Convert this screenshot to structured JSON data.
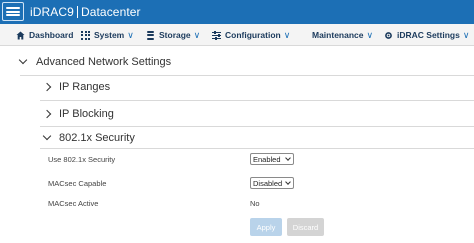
{
  "header": {
    "product": "iDRAC9",
    "edition": "Datacenter"
  },
  "nav": {
    "items": [
      {
        "label": "Dashboard",
        "icon": "home-icon",
        "has_menu": false
      },
      {
        "label": "System",
        "icon": "grid-icon",
        "has_menu": true
      },
      {
        "label": "Storage",
        "icon": "database-icon",
        "has_menu": true
      },
      {
        "label": "Configuration",
        "icon": "sliders-icon",
        "has_menu": true
      },
      {
        "label": "Maintenance",
        "icon": "",
        "has_menu": true
      },
      {
        "label": "iDRAC Settings",
        "icon": "settings-icon",
        "has_menu": true
      }
    ],
    "chevron": "∨"
  },
  "content": {
    "section_title": "Advanced Network Settings",
    "subsections": {
      "ip_ranges": "IP Ranges",
      "ip_blocking": "IP Blocking",
      "security": "802.1x Security"
    },
    "fields": {
      "use_8021x": {
        "label": "Use 802.1x Security",
        "value": "Enabled"
      },
      "macsec_capable": {
        "label": "MACsec Capable",
        "value": "Disabled"
      },
      "macsec_active": {
        "label": "MACsec Active",
        "value": "No"
      }
    },
    "buttons": {
      "apply": "Apply",
      "discard": "Discard"
    }
  },
  "colors": {
    "header_bg": "#1c6fb5",
    "nav_text": "#1b3a5c",
    "apply_disabled": "#b9d3ea",
    "discard_disabled": "#d4d4d4"
  }
}
